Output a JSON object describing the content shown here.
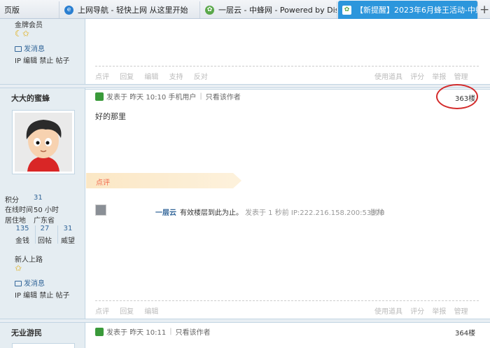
{
  "tabs": [
    {
      "label": "页版"
    },
    {
      "label": "上网导航 - 轻快上网 从这里开始"
    },
    {
      "label": "一层云 - 中蜂网 - Powered by Discu"
    },
    {
      "label": "【新提醒】2023年6月蜂王活动-中蜂"
    }
  ],
  "colors": {
    "accent": "#2c96dc",
    "sidebar": "#e5edf2",
    "link": "#336699",
    "dianping": "#f26c4f"
  },
  "post1_user": {
    "group": "金牌会员",
    "message": "发消息",
    "admin_links": "IP 编辑 禁止 帖子"
  },
  "post_actions": {
    "left": [
      "点评",
      "回复",
      "编辑",
      "支持",
      "反对"
    ],
    "right": [
      "使用道具",
      "评分",
      "举报",
      "管理"
    ]
  },
  "post2": {
    "username": "大大的蜜蜂",
    "meta_posted": "发表于",
    "meta_time": "昨天 10:10",
    "meta_device": "手机用户",
    "meta_only_author": "只看该作者",
    "floor": "363楼",
    "body": "好的那里",
    "dianping_label": "点评",
    "comment_user": "一层云",
    "comment_text": "有效楼层到此为止。",
    "comment_meta": "发表于 1 秒前 IP:222.216.158.200:53370",
    "comment_delete": "删除",
    "stats": {
      "points_label": "积分",
      "points": "31",
      "online_label": "在线时间",
      "online": "50 小时",
      "location_label": "居住地",
      "location": "广东省",
      "coins": "135",
      "coins_label": "金钱",
      "posts": "27",
      "posts_label": "回帖",
      "prestige": "31",
      "prestige_label": "威望"
    },
    "group": "新人上路",
    "message": "发消息",
    "admin_links": "IP 编辑 禁止 帖子",
    "actions_left": [
      "点评",
      "回复",
      "编辑"
    ]
  },
  "post3": {
    "username": "无业游民",
    "meta_posted": "发表于",
    "meta_time": "昨天 10:11",
    "meta_only_author": "只看该作者",
    "floor": "364楼"
  }
}
